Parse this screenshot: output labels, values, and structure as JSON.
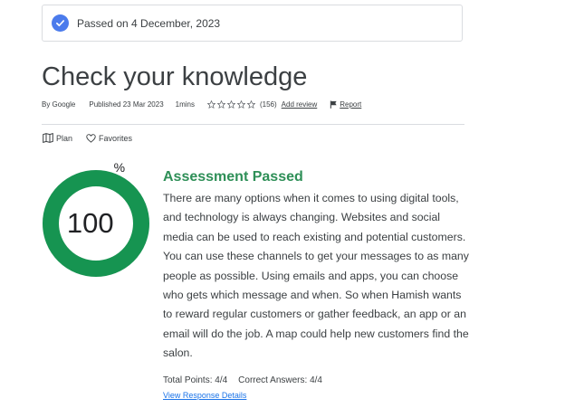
{
  "banner": {
    "icon": "check-circle-icon",
    "text": "Passed on 4 December, 2023",
    "icon_color": "#4b7bec"
  },
  "page": {
    "title": "Check your knowledge"
  },
  "meta": {
    "author": "By Google",
    "published": "Published 23 Mar 2023",
    "duration": "1mins",
    "rating_stars": 0,
    "rating_count": "(156)",
    "add_review": "Add review",
    "report": "Report"
  },
  "actions": {
    "plan_label": "Plan",
    "favorites_label": "Favorites"
  },
  "result": {
    "score_value": "100",
    "score_unit": "%",
    "score_fraction": 1.0,
    "ring_color": "#169451",
    "title": "Assessment Passed",
    "title_color": "#2e8f57",
    "body": "There are many options when it comes to using digital tools, and technology is always changing. Websites and social media can be used to reach existing and potential customers. You can use these channels to get your messages to as many people as possible. Using emails and apps, you can choose who gets which message and when. So when Hamish wants to reward regular customers or gather feedback, an app or an email will do the job. A map could help new customers find the salon.",
    "total_points": "Total Points: 4/4",
    "correct_answers": "Correct Answers: 4/4",
    "view_details": "View Response Details"
  }
}
